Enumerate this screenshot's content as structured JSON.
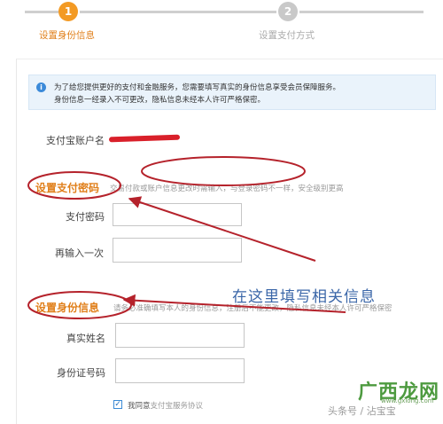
{
  "stepper": {
    "steps": [
      {
        "number": "1",
        "label": "设置身份信息",
        "active": true
      },
      {
        "number": "2",
        "label": "设置支付方式",
        "active": false
      }
    ],
    "active_color": "#f39a24",
    "inactive_color": "#c9c9c9"
  },
  "notice": {
    "icon": "info-icon",
    "line1": "为了给您提供更好的支付和金融服务，您需要填写真实的身份信息享受会员保障服务。",
    "line2": "身份信息一经录入不可更改，隐私信息未经本人许可严格保密。"
  },
  "account": {
    "label": "支付宝账户名"
  },
  "pay_password": {
    "title": "设置支付密码",
    "hint": "交易付款或账户信息更改时需输入，与登录密码不一样，安全级别更高",
    "password_label": "支付密码",
    "confirm_label": "再输入一次",
    "password_value": "",
    "confirm_value": ""
  },
  "identity": {
    "title": "设置身份信息",
    "hint": "请务必准确填写本人的身份信息，注册后不能更改，隐私信息未经本人许可严格保密",
    "name_label": "真实姓名",
    "id_label": "身份证号码",
    "name_value": "",
    "id_value": ""
  },
  "agreement": {
    "checked": true,
    "prefix": "我同意",
    "link": "支付宝服务协议"
  },
  "annotation": {
    "text": "在这里填写相关信息",
    "color": "#3a66a8"
  },
  "watermark": {
    "logo": "广西龙网",
    "url": "www.gxlong.com",
    "credit": "头条号 / 沾宝宝"
  },
  "colors": {
    "accent": "#e07f1a",
    "annotation_red": "#b5222b"
  }
}
